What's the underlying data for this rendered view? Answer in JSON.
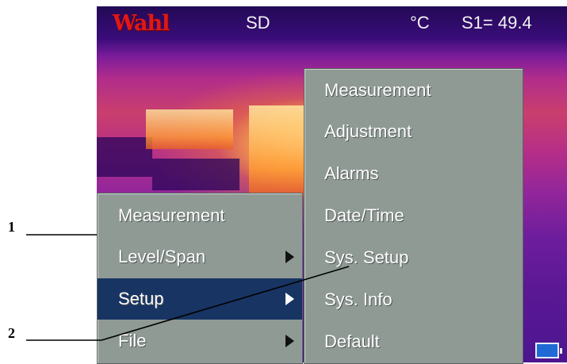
{
  "header": {
    "logo": "Wahl",
    "storage": "SD",
    "unit": "°C",
    "spot_reading": "S1= 49.4"
  },
  "main_menu": {
    "items": [
      {
        "label": "Measurement",
        "has_submenu": false,
        "selected": false
      },
      {
        "label": "Level/Span",
        "has_submenu": true,
        "selected": false
      },
      {
        "label": "Setup",
        "has_submenu": true,
        "selected": true
      },
      {
        "label": "File",
        "has_submenu": true,
        "selected": false
      }
    ]
  },
  "setup_submenu": {
    "items": [
      {
        "label": "Measurement"
      },
      {
        "label": "Adjustment"
      },
      {
        "label": "Alarms"
      },
      {
        "label": "Date/Time"
      },
      {
        "label": "Sys. Setup"
      },
      {
        "label": "Sys. Info"
      },
      {
        "label": "Default"
      }
    ]
  },
  "callouts": {
    "one": "1",
    "two": "2"
  },
  "colors": {
    "menu_bg": "#8f9a95",
    "selected_bg": "#173463",
    "logo": "#e01818",
    "battery": "#1f6ad4"
  },
  "icons": {
    "battery": "battery-icon",
    "submenu_arrow": "chevron-right-icon"
  }
}
